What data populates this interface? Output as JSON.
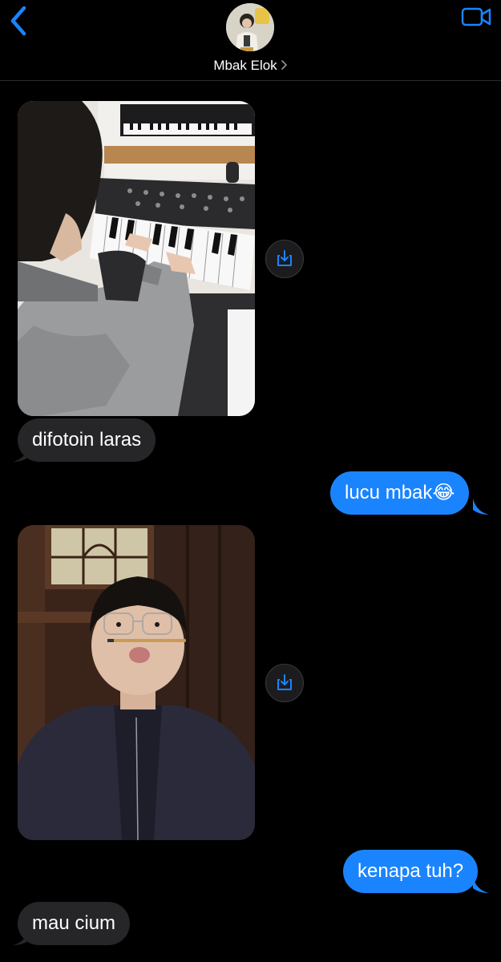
{
  "header": {
    "contact_name": "Mbak Elok",
    "back_icon": "chevron-left-icon",
    "video_icon": "video-camera-icon",
    "accent_color": "#1a84ff"
  },
  "messages": [
    {
      "type": "image",
      "direction": "received",
      "description_icon": "photo-piano"
    },
    {
      "type": "text",
      "direction": "received",
      "text": "difotoin laras"
    },
    {
      "type": "text",
      "direction": "sent",
      "text": "lucu mbak😂"
    },
    {
      "type": "image",
      "direction": "received",
      "description_icon": "photo-portrait"
    },
    {
      "type": "text",
      "direction": "sent",
      "text": "kenapa tuh?"
    },
    {
      "type": "text",
      "direction": "received",
      "text": "mau cium"
    }
  ],
  "colors": {
    "background": "#000000",
    "received_bubble": "#262628",
    "sent_bubble": "#1a84ff"
  }
}
